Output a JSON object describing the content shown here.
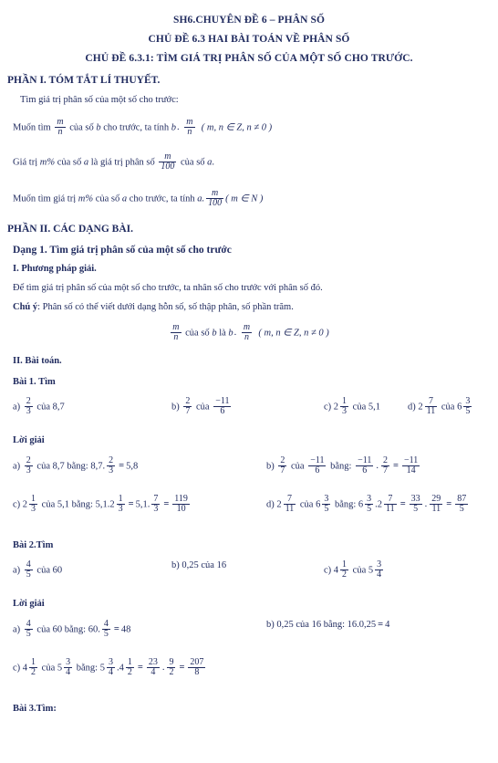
{
  "document": {
    "titles": [
      "SH6.CHUYÊN ĐỀ 6 – PHÂN SỐ",
      "CHỦ ĐỀ 6.3 HAI BÀI TOÁN VỀ PHÂN SỐ",
      "CHỦ ĐỀ 6.3.1: TÌM GIÁ TRỊ PHÂN SỐ CỦA MỘT SỐ CHO TRƯỚC."
    ],
    "part1_heading": "PHẦN I. TÓM TẮT LÍ THUYẾT.",
    "part1_intro": "Tìm giá trị phân số của một số cho trước:",
    "rule1": {
      "prefix": "Muốn tìm",
      "frac_num": "m",
      "frac_den": "n",
      "mid": "của số",
      "var_b": "b",
      "tail": "cho trước, ta tính",
      "b2": "b",
      "dot": ".",
      "f2_num": "m",
      "f2_den": "n",
      "cond": "( m, n ∈ Z, n ≠ 0 )"
    },
    "rule2": {
      "prefix": "Giá trị",
      "mpercent": "m%",
      "mid": "của số",
      "var_a": "a",
      "mid2": "là giá trị phân số",
      "frac_num": "m",
      "frac_den": "100",
      "tail": "của số",
      "var_a2": "a",
      "period": "."
    },
    "rule3": {
      "prefix": "Muốn tìm giá trị",
      "mpercent": "m%",
      "mid": "của số",
      "var_a": "a",
      "tail": "cho trước, ta tính",
      "a_dot": "a.",
      "frac_num": "m",
      "frac_den": "100",
      "cond": "( m ∈ N )"
    },
    "part2_heading": "PHẦN II. CÁC DẠNG BÀI.",
    "dang1_heading": "Dạng 1. Tìm giá trị phân số của một số cho trước",
    "method_heading": "I. Phương pháp giải.",
    "method_text": "Để tìm giá trị phân số của một số cho trước, ta nhân số cho trước với phân số đó.",
    "note_label": "Chú ý",
    "note_text": ": Phân số có thể viết dưới dạng hỗn số, số thập phân, số phần trăm.",
    "center_formula": {
      "f_num": "m",
      "f_den": "n",
      "t1": "của số",
      "b": "b",
      "t2": "là",
      "b2": "b",
      "dot": ".",
      "f2_num": "m",
      "f2_den": "n",
      "cond": "( m, n ∈ Z, n ≠ 0 )"
    },
    "bai_toan_heading": "II. Bài toán."
  },
  "bai1": {
    "heading": "Bài 1. Tìm",
    "problems": {
      "a": {
        "label": "a)",
        "num": "2",
        "den": "3",
        "cua": "của",
        "val": "8,7"
      },
      "b": {
        "label": "b)",
        "num": "2",
        "den": "7",
        "cua": "của",
        "val_num": "−11",
        "val_den": "6"
      },
      "c": {
        "label": "c)",
        "whole": "2",
        "num": "1",
        "den": "3",
        "cua": "của",
        "val": "5,1"
      },
      "d": {
        "label": "d)",
        "whole": "2",
        "num": "7",
        "den": "11",
        "cua": "của",
        "val_whole": "6",
        "val_num": "3",
        "val_den": "5"
      }
    },
    "solution_heading": "Lời giải",
    "solutions": {
      "a": {
        "label": "a)",
        "num": "2",
        "den": "3",
        "cua": "của",
        "val": "8,7",
        "bang": "bằng:",
        "r1": "8,7.",
        "r_num": "2",
        "r_den": "3",
        "eq": "=",
        "result": "5,8"
      },
      "b": {
        "label": "b)",
        "num": "2",
        "den": "7",
        "cua": "của",
        "v_num": "−11",
        "v_den": "6",
        "bang": "bằng:",
        "s1_num": "−11",
        "s1_den": "6",
        "dot": ".",
        "s2_num": "2",
        "s2_den": "7",
        "eq": "=",
        "res_num": "−11",
        "res_den": "14"
      },
      "c": {
        "label": "c)",
        "whole": "2",
        "num": "1",
        "den": "3",
        "cua": "của",
        "val": "5,1",
        "bang": "bằng:",
        "s1": "5,1.2",
        "s1_num": "1",
        "s1_den": "3",
        "eq1": "=",
        "s2": "5,1.",
        "s2_num": "7",
        "s2_den": "3",
        "eq2": "=",
        "res_num": "119",
        "res_den": "10"
      },
      "d": {
        "label": "d)",
        "whole": "2",
        "num": "7",
        "den": "11",
        "cua": "của",
        "v_whole": "6",
        "v_num": "3",
        "v_den": "5",
        "bang": "bằng:",
        "s1": "6",
        "s1_num": "3",
        "s1_den": "5",
        "s2": ".2",
        "s2_num": "7",
        "s2_den": "11",
        "eq1": "=",
        "m1_num": "33",
        "m1_den": "5",
        "dot": ".",
        "m2_num": "29",
        "m2_den": "11",
        "eq2": "=",
        "res_num": "87",
        "res_den": "5"
      }
    }
  },
  "bai2": {
    "heading": "Bài 2.Tìm",
    "problems": {
      "a": {
        "label": "a)",
        "num": "4",
        "den": "5",
        "cua": "của",
        "val": "60"
      },
      "b": {
        "label": "b)",
        "val1": "0,25",
        "cua": "của",
        "val2": "16"
      },
      "c": {
        "label": "c)",
        "whole": "4",
        "num": "1",
        "den": "2",
        "cua": "của",
        "v_whole": "5",
        "v_num": "3",
        "v_den": "4"
      }
    },
    "solution_heading": "Lời giải",
    "solutions": {
      "a": {
        "label": "a)",
        "num": "4",
        "den": "5",
        "cua": "của",
        "val": "60",
        "bang": "bằng:",
        "s1": "60.",
        "s_num": "4",
        "s_den": "5",
        "eq": "=",
        "result": "48"
      },
      "b": {
        "label": "b)",
        "val1": "0,25",
        "cua": "của",
        "val2": "16",
        "bang": "bằng:",
        "expr": "16.0,25",
        "eq": "=",
        "result": "4"
      },
      "c": {
        "label": "c)",
        "whole": "4",
        "num": "1",
        "den": "2",
        "cua": "của",
        "v_whole": "5",
        "v_num": "3",
        "v_den": "4",
        "bang": "bằng:",
        "s1": "5",
        "s1_num": "3",
        "s1_den": "4",
        "s2": ".4",
        "s2_num": "1",
        "s2_den": "2",
        "eq1": "=",
        "m1_num": "23",
        "m1_den": "4",
        "dot": ".",
        "m2_num": "9",
        "m2_den": "2",
        "eq2": "=",
        "res_num": "207",
        "res_den": "8"
      }
    }
  },
  "bai3": {
    "heading": "Bài 3.Tìm:"
  },
  "colors": {
    "text": "#1f2a5e"
  }
}
